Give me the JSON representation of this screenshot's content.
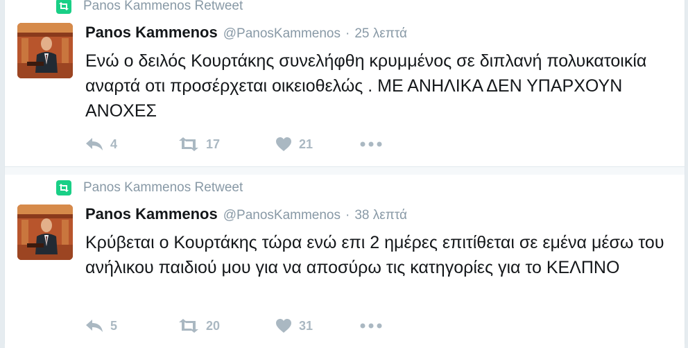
{
  "tweets": [
    {
      "retweet_context": "Panos Kammenos Retweet",
      "fullname": "Panos Kammenos",
      "handle": "@PanosKammenos",
      "separator": "·",
      "time": "25 λεπτά",
      "text": "Ενώ ο δειλός Κουρτάκης συνελήφθη κρυμμένος σε διπλανή πολυκατοικία αναρτά οτι προσέρχεται οικειοθελώς . ΜΕ ΑΝΗΛΙΚΑ ΔΕΝ ΥΠΑΡΧΟΥΝ ΑΝΟΧΕΣ",
      "replies": "4",
      "retweets": "17",
      "likes": "21"
    },
    {
      "retweet_context": "Panos Kammenos Retweet",
      "fullname": "Panos Kammenos",
      "handle": "@PanosKammenos",
      "separator": "·",
      "time": "38 λεπτά",
      "text": "Κρύβεται ο Κουρτάκης τώρα ενώ επι 2 ημέρες επιτίθεται σε εμένα μέσω του ανήλικου παιδιού μου για να αποσύρω τις κατηγορίες για το ΚΕΛΠΝΟ",
      "replies": "5",
      "retweets": "20",
      "likes": "31"
    }
  ],
  "icons": {
    "retweet_badge": "retweet-icon",
    "reply": "reply-icon",
    "retweet": "retweet-icon",
    "like": "heart-icon",
    "more": "more-icon"
  },
  "colors": {
    "retweet_green": "#19cf86",
    "muted": "#8899a6",
    "action_gray": "#aab8c2",
    "text": "#14171a"
  }
}
